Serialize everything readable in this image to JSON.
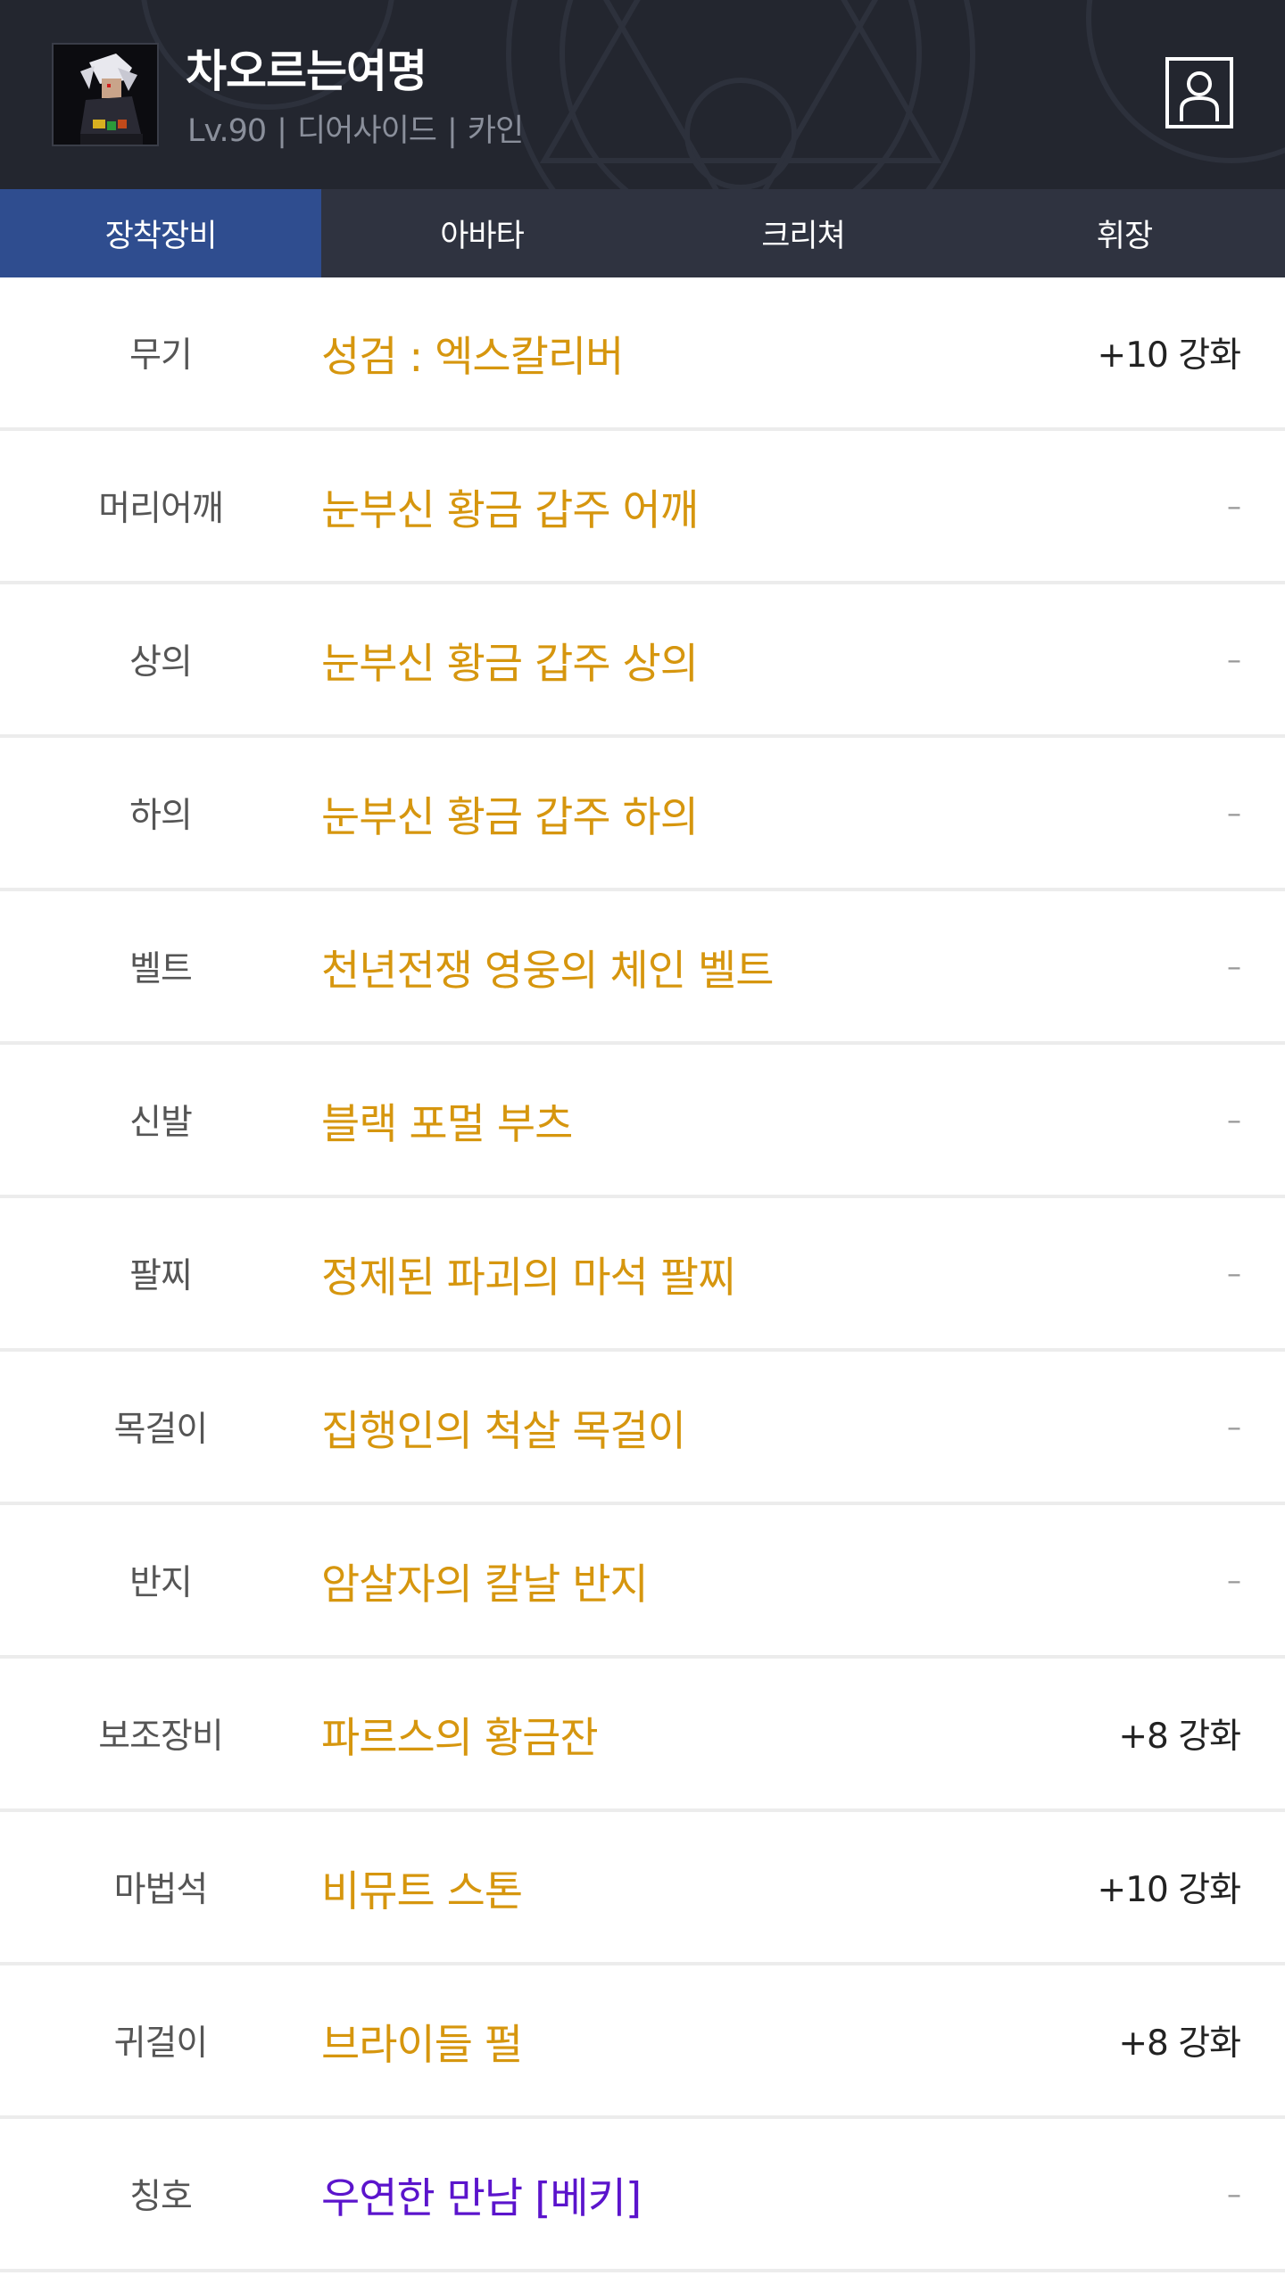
{
  "colors": {
    "header_bg": "#23262f",
    "tab_bg": "#2f3340",
    "tab_active_bg": "#2f4d8f",
    "item_gold": "#d6960e",
    "item_purple": "#5b14cc",
    "divider": "#ececec"
  },
  "header": {
    "avatar_icon": "character-portrait",
    "name": "차오르는여명",
    "level": "Lv.90",
    "separator": "|",
    "job": "디어사이드",
    "server": "카인",
    "profile_icon": "user-profile-icon"
  },
  "tabs": [
    {
      "label": "장착장비",
      "active": true
    },
    {
      "label": "아바타",
      "active": false
    },
    {
      "label": "크리쳐",
      "active": false
    },
    {
      "label": "휘장",
      "active": false
    }
  ],
  "equipment": [
    {
      "slot": "무기",
      "name": "성검 : 엑스칼리버",
      "status": "+10 강화",
      "rarity": "gold"
    },
    {
      "slot": "머리어깨",
      "name": "눈부신 황금 갑주 어깨",
      "status": "–",
      "rarity": "gold"
    },
    {
      "slot": "상의",
      "name": "눈부신 황금 갑주 상의",
      "status": "–",
      "rarity": "gold"
    },
    {
      "slot": "하의",
      "name": "눈부신 황금 갑주 하의",
      "status": "–",
      "rarity": "gold"
    },
    {
      "slot": "벨트",
      "name": "천년전쟁 영웅의 체인 벨트",
      "status": "–",
      "rarity": "gold"
    },
    {
      "slot": "신발",
      "name": "블랙 포멀 부츠",
      "status": "–",
      "rarity": "gold"
    },
    {
      "slot": "팔찌",
      "name": "정제된 파괴의 마석 팔찌",
      "status": "–",
      "rarity": "gold"
    },
    {
      "slot": "목걸이",
      "name": "집행인의 척살 목걸이",
      "status": "–",
      "rarity": "gold"
    },
    {
      "slot": "반지",
      "name": "암살자의 칼날 반지",
      "status": "–",
      "rarity": "gold"
    },
    {
      "slot": "보조장비",
      "name": "파르스의 황금잔",
      "status": "+8 강화",
      "rarity": "gold"
    },
    {
      "slot": "마법석",
      "name": "비뮤트 스톤",
      "status": "+10 강화",
      "rarity": "gold"
    },
    {
      "slot": "귀걸이",
      "name": "브라이들 펄",
      "status": "+8 강화",
      "rarity": "gold"
    },
    {
      "slot": "칭호",
      "name": "우연한 만남 [베키]",
      "status": "–",
      "rarity": "purple"
    }
  ]
}
